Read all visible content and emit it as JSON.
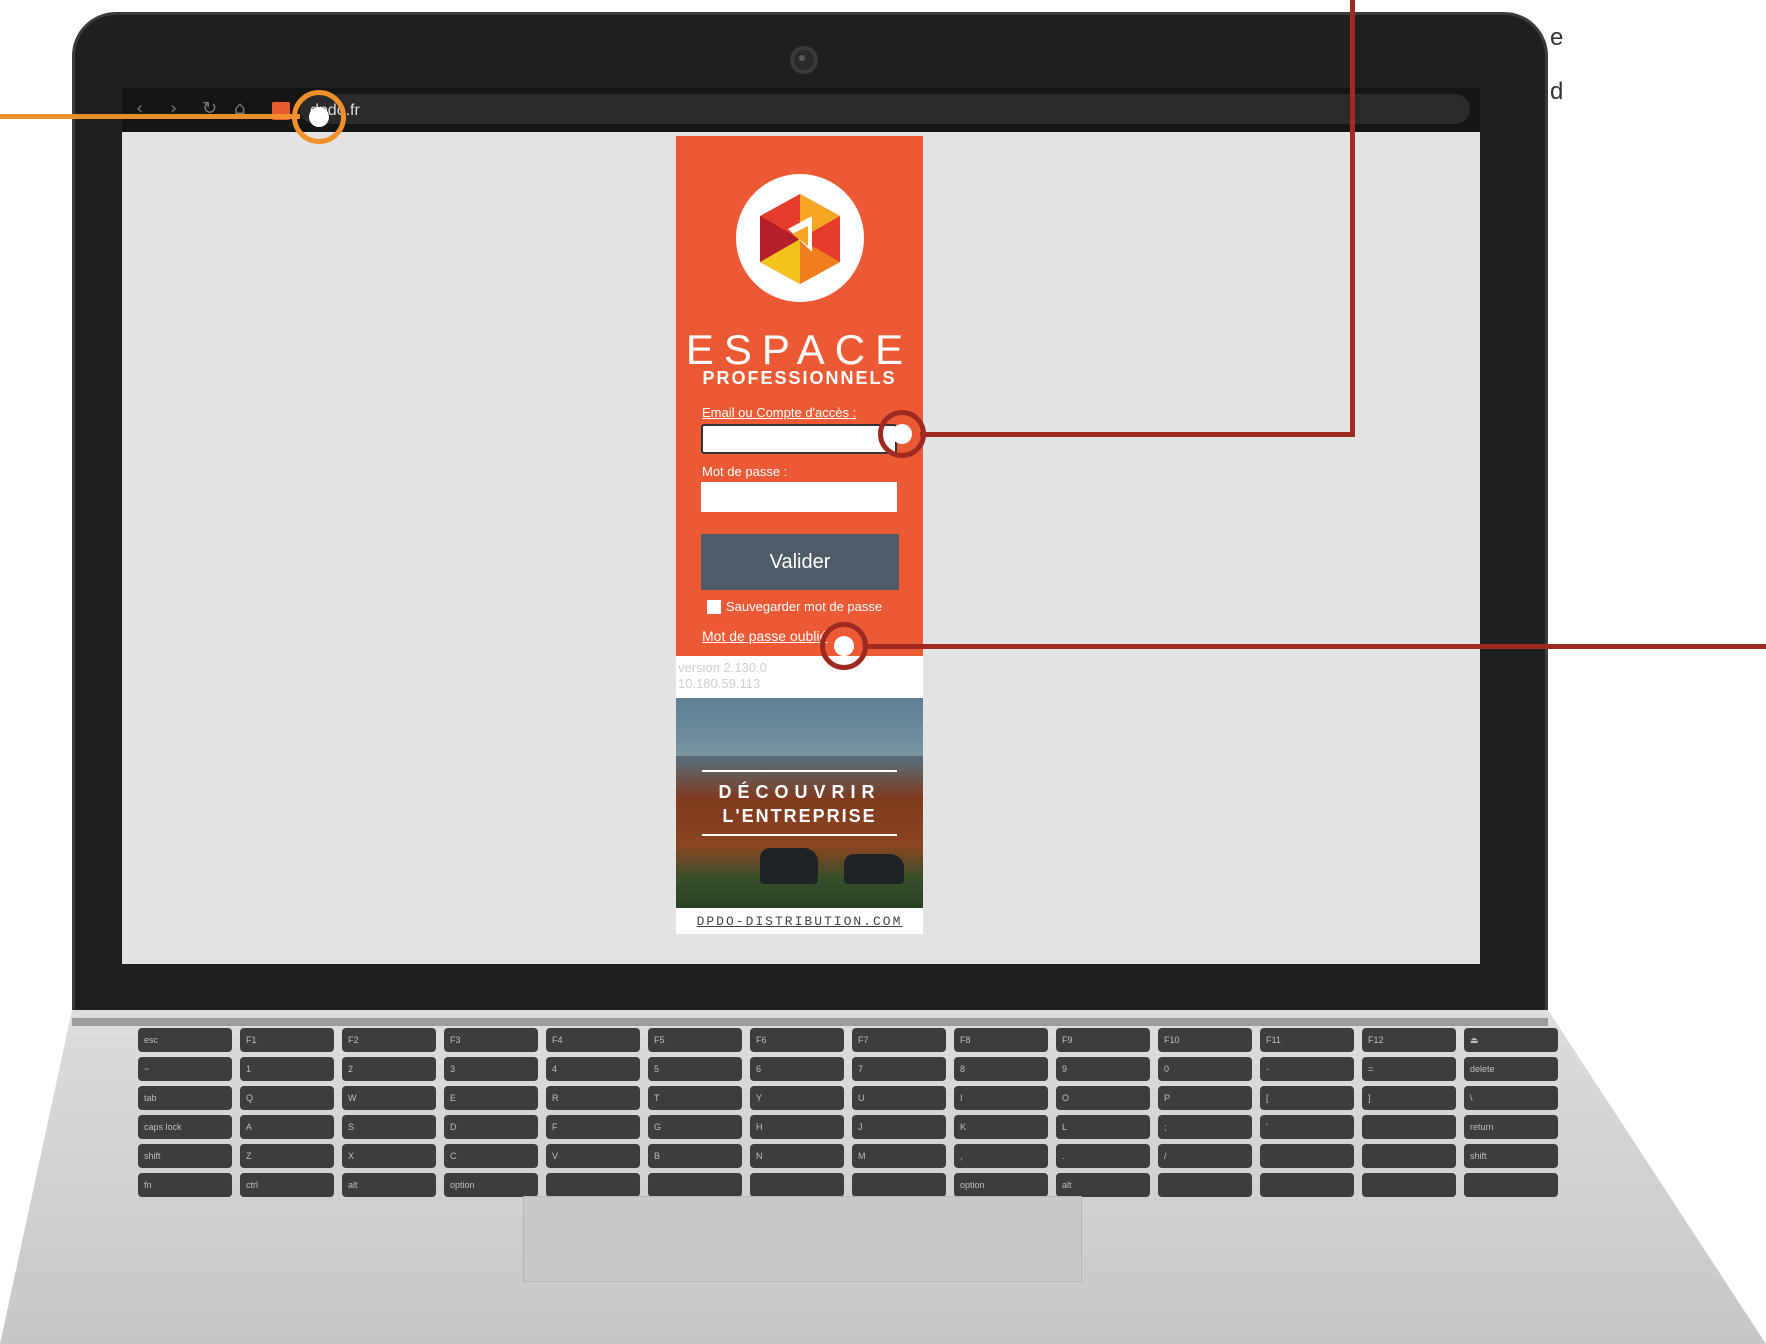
{
  "browser": {
    "url": "dpdo.fr",
    "back_icon": "chevron-left-icon",
    "forward_icon": "chevron-right-icon",
    "reload_icon": "reload-icon",
    "home_icon": "home-icon"
  },
  "login": {
    "espace": "ESPACE",
    "professionnels": "PROFESSIONNELS",
    "email_label": "Email ou Compte d'accès :",
    "email_value": "",
    "password_label": "Mot de passe :",
    "password_value": "",
    "submit_label": "Valider",
    "remember_label": "Sauvegarder mot de passe",
    "remember_checked": false,
    "forgot_label": "Mot de passe oublié",
    "version": "version 2.130.0",
    "ip": "10.180.59.113"
  },
  "banner": {
    "line1": "DÉCOUVRIR",
    "line2": "L'ENTREPRISE",
    "site": "DPDO-DISTRIBUTION.COM"
  },
  "side_text": {
    "line1": "e",
    "line2": "d"
  },
  "keyboard": {
    "row1": [
      "esc",
      "F1",
      "F2",
      "F3",
      "F4",
      "F5",
      "F6",
      "F7",
      "F8",
      "F9",
      "F10",
      "F11",
      "F12",
      "⏏"
    ],
    "row2": [
      "~",
      "1",
      "2",
      "3",
      "4",
      "5",
      "6",
      "7",
      "8",
      "9",
      "0",
      "-",
      "=",
      "delete"
    ],
    "row3": [
      "tab",
      "Q",
      "W",
      "E",
      "R",
      "T",
      "Y",
      "U",
      "I",
      "O",
      "P",
      "[",
      "]",
      "\\"
    ],
    "row4": [
      "caps lock",
      "A",
      "S",
      "D",
      "F",
      "G",
      "H",
      "J",
      "K",
      "L",
      ";",
      "'",
      "",
      "return"
    ],
    "row5": [
      "shift",
      "Z",
      "X",
      "C",
      "V",
      "B",
      "N",
      "M",
      ",",
      ".",
      "/",
      "",
      "",
      "shift"
    ],
    "row6": [
      "fn",
      "ctrl",
      "alt",
      "option",
      "",
      "",
      "",
      "",
      "option",
      "alt",
      "",
      "",
      "",
      ""
    ]
  },
  "colors": {
    "brand_orange": "#eb5a35",
    "button": "#4f5b66",
    "callout_orange": "#f0902a",
    "callout_red": "#9e2a22"
  }
}
